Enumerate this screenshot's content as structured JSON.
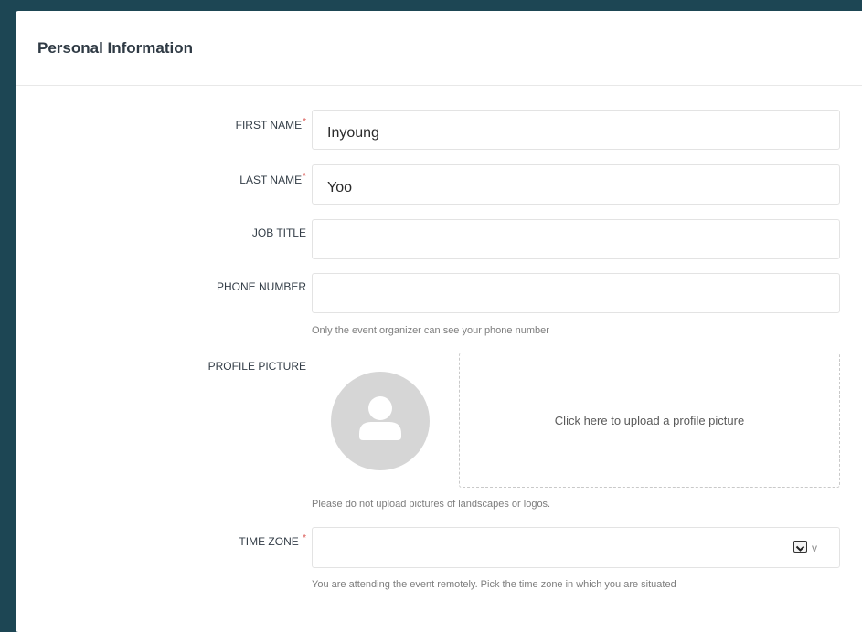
{
  "section": {
    "title": "Personal Information"
  },
  "form": {
    "first_name": {
      "label": "FIRST NAME",
      "required_mark": "*",
      "value": "Inyoung"
    },
    "last_name": {
      "label": "LAST NAME",
      "required_mark": "*",
      "value": "Yoo"
    },
    "job_title": {
      "label": "JOB TITLE",
      "value": ""
    },
    "phone_number": {
      "label": "PHONE NUMBER",
      "value": "",
      "hint": "Only the event organizer can see your phone number"
    },
    "profile_picture": {
      "label": "PROFILE PICTURE",
      "upload_text": "Click here to upload a profile picture",
      "hint": "Please do not upload pictures of landscapes or logos.",
      "avatar_icon": "user-silhouette-icon"
    },
    "time_zone": {
      "label": "TIME ZONE",
      "required_mark": "*",
      "value": "",
      "dropdown_glyph": "v",
      "hint": "You are attending the event remotely. Pick the time zone in which you are situated"
    }
  },
  "colors": {
    "background": "#1d4654",
    "card": "#ffffff",
    "required": "#d9534f",
    "avatar": "#d6d6d6"
  }
}
